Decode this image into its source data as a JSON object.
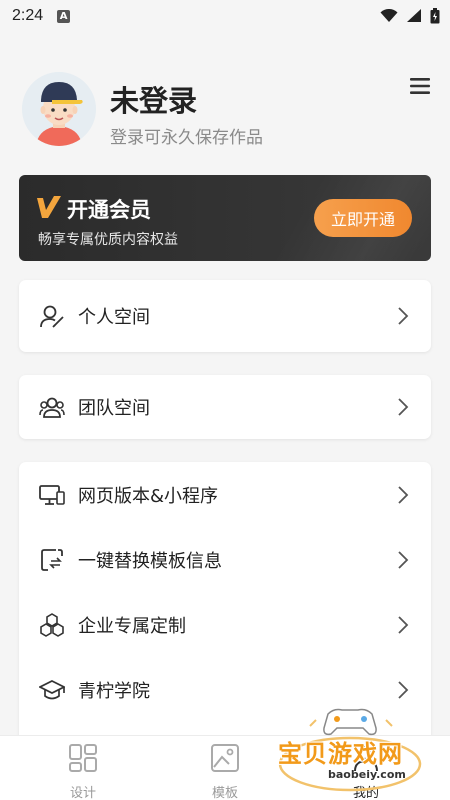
{
  "status_bar": {
    "time": "2:24",
    "notification_glyph": "A"
  },
  "profile": {
    "username": "未登录",
    "subtitle": "登录可永久保存作品"
  },
  "vip": {
    "title": "开通会员",
    "description": "畅享专属优质内容权益",
    "button_label": "立即开通"
  },
  "menu": {
    "personal_space": "个人空间",
    "team_space": "团队空间",
    "group3": [
      {
        "label": "网页版本&小程序",
        "icon": "monitor-phone-icon"
      },
      {
        "label": "一键替换模板信息",
        "icon": "replace-doc-icon"
      },
      {
        "label": "企业专属定制",
        "icon": "hexagons-icon"
      },
      {
        "label": "青柠学院",
        "icon": "graduation-cap-icon"
      }
    ]
  },
  "bottom_nav": [
    {
      "label": "设计",
      "icon": "grid-icon"
    },
    {
      "label": "模板",
      "icon": "template-image-icon"
    },
    {
      "label": "我的",
      "icon": "user-icon"
    }
  ],
  "watermark": {
    "text": "宝贝游戏网",
    "url": "baobeiy.com"
  },
  "colors": {
    "accent": "#f0882f",
    "vip_bg": "#2b2b2b",
    "page_bg": "#f5f5f5"
  }
}
